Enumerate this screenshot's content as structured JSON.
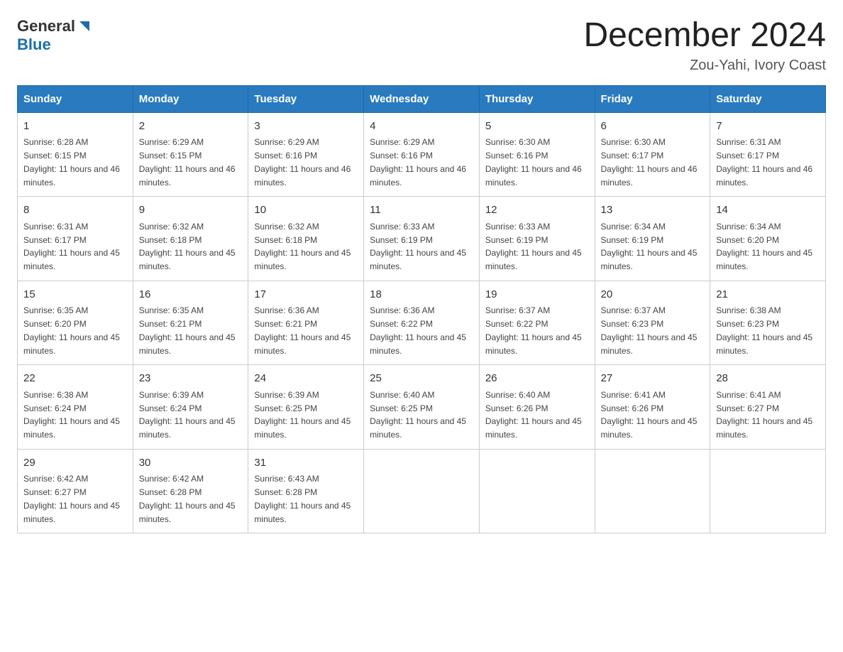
{
  "logo": {
    "general": "General",
    "triangle": "▶",
    "blue": "Blue"
  },
  "header": {
    "month_year": "December 2024",
    "location": "Zou-Yahi, Ivory Coast"
  },
  "weekdays": [
    "Sunday",
    "Monday",
    "Tuesday",
    "Wednesday",
    "Thursday",
    "Friday",
    "Saturday"
  ],
  "weeks": [
    [
      {
        "day": "1",
        "sunrise": "6:28 AM",
        "sunset": "6:15 PM",
        "daylight": "11 hours and 46 minutes."
      },
      {
        "day": "2",
        "sunrise": "6:29 AM",
        "sunset": "6:15 PM",
        "daylight": "11 hours and 46 minutes."
      },
      {
        "day": "3",
        "sunrise": "6:29 AM",
        "sunset": "6:16 PM",
        "daylight": "11 hours and 46 minutes."
      },
      {
        "day": "4",
        "sunrise": "6:29 AM",
        "sunset": "6:16 PM",
        "daylight": "11 hours and 46 minutes."
      },
      {
        "day": "5",
        "sunrise": "6:30 AM",
        "sunset": "6:16 PM",
        "daylight": "11 hours and 46 minutes."
      },
      {
        "day": "6",
        "sunrise": "6:30 AM",
        "sunset": "6:17 PM",
        "daylight": "11 hours and 46 minutes."
      },
      {
        "day": "7",
        "sunrise": "6:31 AM",
        "sunset": "6:17 PM",
        "daylight": "11 hours and 46 minutes."
      }
    ],
    [
      {
        "day": "8",
        "sunrise": "6:31 AM",
        "sunset": "6:17 PM",
        "daylight": "11 hours and 45 minutes."
      },
      {
        "day": "9",
        "sunrise": "6:32 AM",
        "sunset": "6:18 PM",
        "daylight": "11 hours and 45 minutes."
      },
      {
        "day": "10",
        "sunrise": "6:32 AM",
        "sunset": "6:18 PM",
        "daylight": "11 hours and 45 minutes."
      },
      {
        "day": "11",
        "sunrise": "6:33 AM",
        "sunset": "6:19 PM",
        "daylight": "11 hours and 45 minutes."
      },
      {
        "day": "12",
        "sunrise": "6:33 AM",
        "sunset": "6:19 PM",
        "daylight": "11 hours and 45 minutes."
      },
      {
        "day": "13",
        "sunrise": "6:34 AM",
        "sunset": "6:19 PM",
        "daylight": "11 hours and 45 minutes."
      },
      {
        "day": "14",
        "sunrise": "6:34 AM",
        "sunset": "6:20 PM",
        "daylight": "11 hours and 45 minutes."
      }
    ],
    [
      {
        "day": "15",
        "sunrise": "6:35 AM",
        "sunset": "6:20 PM",
        "daylight": "11 hours and 45 minutes."
      },
      {
        "day": "16",
        "sunrise": "6:35 AM",
        "sunset": "6:21 PM",
        "daylight": "11 hours and 45 minutes."
      },
      {
        "day": "17",
        "sunrise": "6:36 AM",
        "sunset": "6:21 PM",
        "daylight": "11 hours and 45 minutes."
      },
      {
        "day": "18",
        "sunrise": "6:36 AM",
        "sunset": "6:22 PM",
        "daylight": "11 hours and 45 minutes."
      },
      {
        "day": "19",
        "sunrise": "6:37 AM",
        "sunset": "6:22 PM",
        "daylight": "11 hours and 45 minutes."
      },
      {
        "day": "20",
        "sunrise": "6:37 AM",
        "sunset": "6:23 PM",
        "daylight": "11 hours and 45 minutes."
      },
      {
        "day": "21",
        "sunrise": "6:38 AM",
        "sunset": "6:23 PM",
        "daylight": "11 hours and 45 minutes."
      }
    ],
    [
      {
        "day": "22",
        "sunrise": "6:38 AM",
        "sunset": "6:24 PM",
        "daylight": "11 hours and 45 minutes."
      },
      {
        "day": "23",
        "sunrise": "6:39 AM",
        "sunset": "6:24 PM",
        "daylight": "11 hours and 45 minutes."
      },
      {
        "day": "24",
        "sunrise": "6:39 AM",
        "sunset": "6:25 PM",
        "daylight": "11 hours and 45 minutes."
      },
      {
        "day": "25",
        "sunrise": "6:40 AM",
        "sunset": "6:25 PM",
        "daylight": "11 hours and 45 minutes."
      },
      {
        "day": "26",
        "sunrise": "6:40 AM",
        "sunset": "6:26 PM",
        "daylight": "11 hours and 45 minutes."
      },
      {
        "day": "27",
        "sunrise": "6:41 AM",
        "sunset": "6:26 PM",
        "daylight": "11 hours and 45 minutes."
      },
      {
        "day": "28",
        "sunrise": "6:41 AM",
        "sunset": "6:27 PM",
        "daylight": "11 hours and 45 minutes."
      }
    ],
    [
      {
        "day": "29",
        "sunrise": "6:42 AM",
        "sunset": "6:27 PM",
        "daylight": "11 hours and 45 minutes."
      },
      {
        "day": "30",
        "sunrise": "6:42 AM",
        "sunset": "6:28 PM",
        "daylight": "11 hours and 45 minutes."
      },
      {
        "day": "31",
        "sunrise": "6:43 AM",
        "sunset": "6:28 PM",
        "daylight": "11 hours and 45 minutes."
      },
      null,
      null,
      null,
      null
    ]
  ]
}
